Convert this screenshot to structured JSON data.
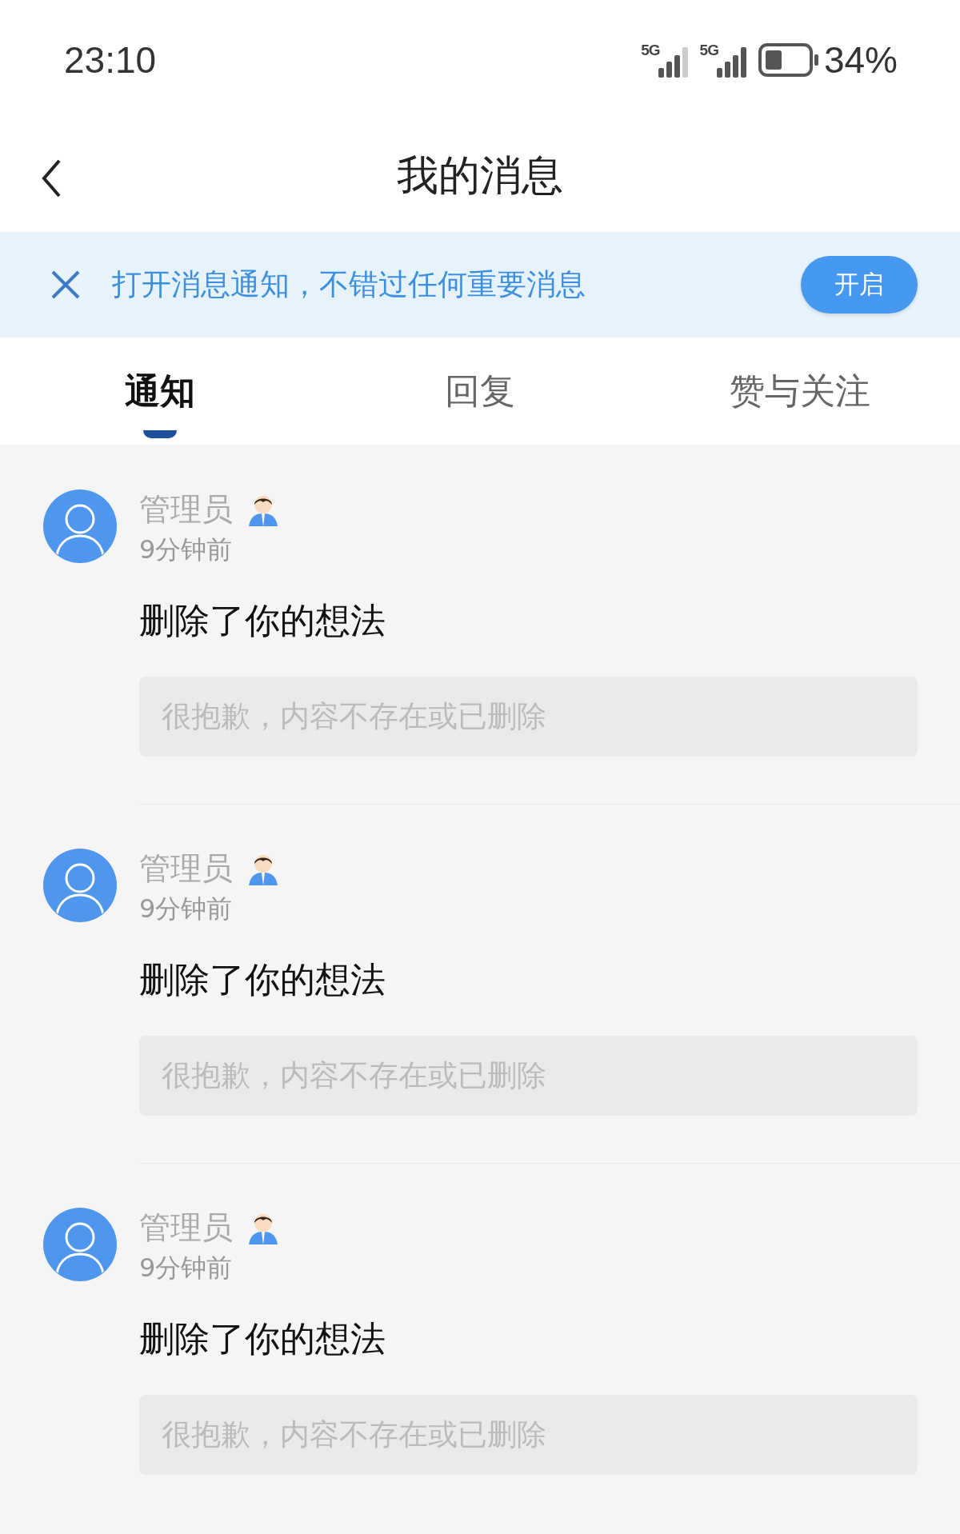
{
  "status_bar": {
    "time": "23:10",
    "network_1": "5G",
    "network_2": "5G",
    "battery": "34%"
  },
  "header": {
    "title": "我的消息"
  },
  "notice_banner": {
    "text": "打开消息通知，不错过任何重要消息",
    "button": "开启"
  },
  "tabs": [
    {
      "label": "通知",
      "selected": true
    },
    {
      "label": "回复",
      "selected": false
    },
    {
      "label": "赞与关注",
      "selected": false
    }
  ],
  "messages": [
    {
      "sender": "管理员",
      "time": "9分钟前",
      "action": "删除了你的想法",
      "quote": "很抱歉，内容不存在或已删除"
    },
    {
      "sender": "管理员",
      "time": "9分钟前",
      "action": "删除了你的想法",
      "quote": "很抱歉，内容不存在或已删除"
    },
    {
      "sender": "管理员",
      "time": "9分钟前",
      "action": "删除了你的想法",
      "quote": "很抱歉，内容不存在或已删除"
    }
  ]
}
